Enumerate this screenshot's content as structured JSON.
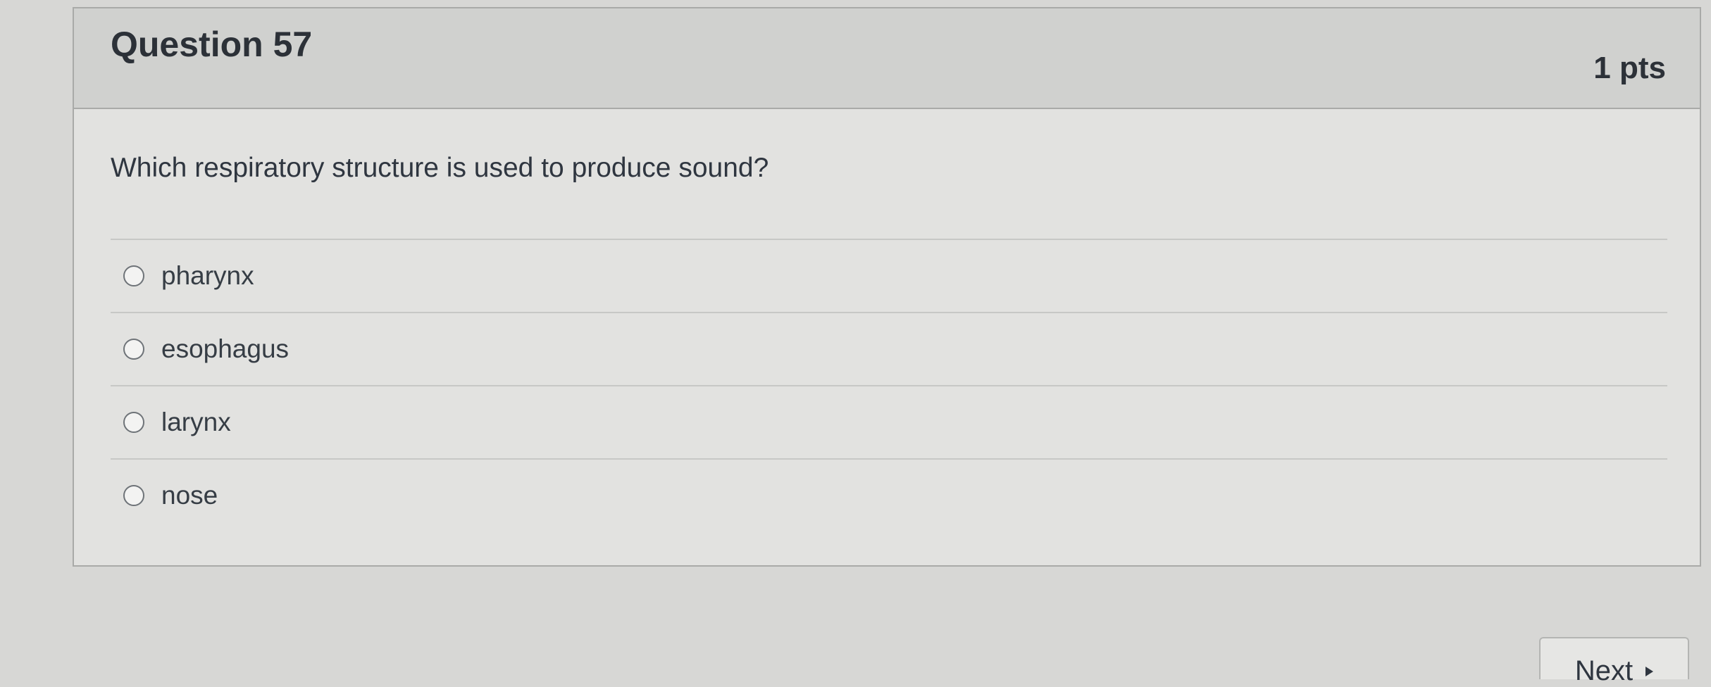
{
  "question": {
    "title": "Question 57",
    "points": "1 pts",
    "text": "Which respiratory structure is used to produce sound?",
    "answers": [
      {
        "label": "pharynx",
        "selected": false
      },
      {
        "label": "esophagus",
        "selected": false
      },
      {
        "label": "larynx",
        "selected": false
      },
      {
        "label": "nose",
        "selected": false
      }
    ]
  },
  "navigation": {
    "next_label": "Next",
    "next_icon": "triangle-right-icon"
  },
  "colors": {
    "page_background": "#d7d7d5",
    "header_background": "#d0d1cf",
    "text": "#2f3640"
  }
}
